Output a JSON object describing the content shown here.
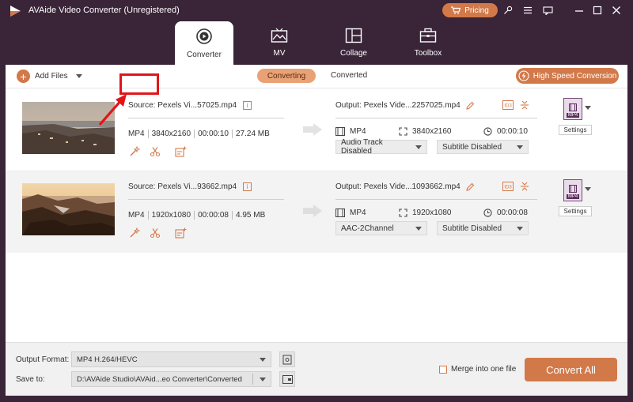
{
  "app": {
    "title": "AVAide Video Converter (Unregistered)",
    "pricing_label": "Pricing",
    "window_icons": [
      "key-icon",
      "menu-icon",
      "feedback-icon",
      "minimize-icon",
      "maximize-icon",
      "close-icon"
    ]
  },
  "nav": {
    "tabs": [
      {
        "label": "Converter",
        "icon": "converter-icon",
        "active": true
      },
      {
        "label": "MV",
        "icon": "mv-icon",
        "active": false
      },
      {
        "label": "Collage",
        "icon": "collage-icon",
        "active": false
      },
      {
        "label": "Toolbox",
        "icon": "toolbox-icon",
        "active": false
      }
    ]
  },
  "toolbar": {
    "add_files_label": "Add Files",
    "converting_label": "Converting",
    "converted_label": "Converted",
    "high_speed_label": "High Speed Conversion"
  },
  "files": [
    {
      "source_name": "Source: Pexels Vi...57025.mp4",
      "format": "MP4",
      "resolution": "3840x2160",
      "duration": "00:00:10",
      "size": "27.24 MB",
      "output_name": "Output: Pexels Vide...2257025.mp4",
      "out_format": "MP4",
      "out_resolution": "3840x2160",
      "out_duration": "00:00:10",
      "audio_track": "Audio Track Disabled",
      "subtitle": "Subtitle Disabled",
      "format_badge": "MP4",
      "settings_label": "Settings"
    },
    {
      "source_name": "Source: Pexels Vi...93662.mp4",
      "format": "MP4",
      "resolution": "1920x1080",
      "duration": "00:00:08",
      "size": "4.95 MB",
      "output_name": "Output: Pexels Vide...1093662.mp4",
      "out_format": "MP4",
      "out_resolution": "1920x1080",
      "out_duration": "00:00:08",
      "audio_track": "AAC-2Channel",
      "subtitle": "Subtitle Disabled",
      "format_badge": "MP4",
      "settings_label": "Settings"
    }
  ],
  "bottom": {
    "output_format_label": "Output Format:",
    "output_format_value": "MP4 H.264/HEVC",
    "save_to_label": "Save to:",
    "save_to_value": "D:\\AVAide Studio\\AVAid...eo Converter\\Converted",
    "merge_label": "Merge into one file",
    "merge_checked": false,
    "convert_all_label": "Convert All"
  },
  "colors": {
    "accent": "#d2794a",
    "titlebar": "#3a2438",
    "highlight": "#e0151a"
  }
}
